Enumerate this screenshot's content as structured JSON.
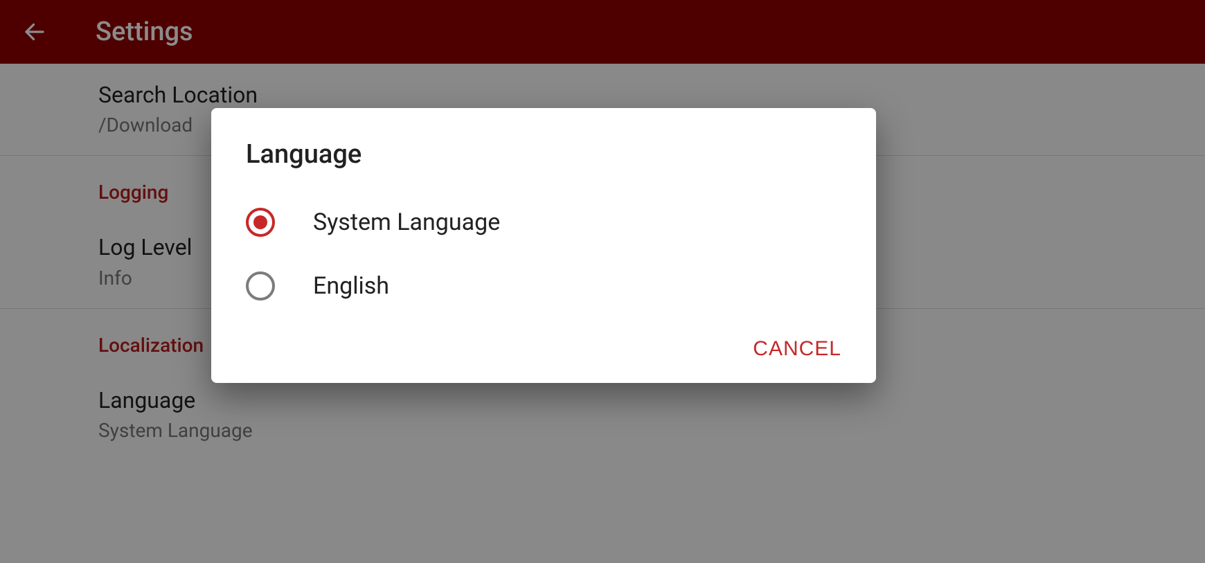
{
  "header": {
    "title": "Settings"
  },
  "settings": {
    "search_location": {
      "title": "Search Location",
      "value": "/Download"
    },
    "logging_header": "Logging",
    "log_level": {
      "title": "Log Level",
      "value": "Info"
    },
    "localization_header": "Localization",
    "language": {
      "title": "Language",
      "value": "System Language"
    }
  },
  "dialog": {
    "title": "Language",
    "options": {
      "0": {
        "label": "System Language",
        "selected": true
      },
      "1": {
        "label": "English",
        "selected": false
      }
    },
    "cancel_label": "CANCEL"
  },
  "colors": {
    "primary": "#8e0000",
    "accent": "#c62828"
  }
}
